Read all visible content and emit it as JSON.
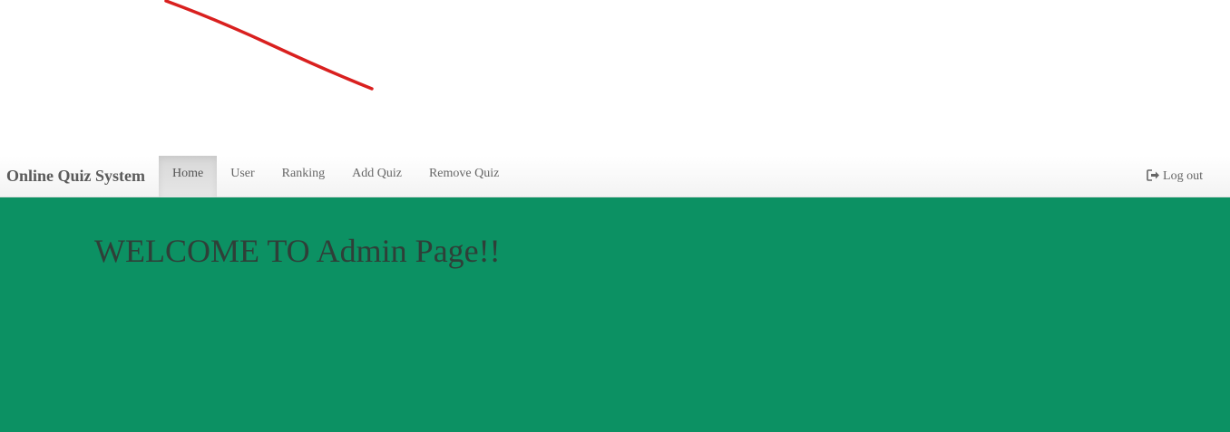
{
  "navbar": {
    "brand": "Online Quiz System",
    "items": [
      {
        "label": "Home",
        "active": true
      },
      {
        "label": "User",
        "active": false
      },
      {
        "label": "Ranking",
        "active": false
      },
      {
        "label": "Add Quiz",
        "active": false
      },
      {
        "label": "Remove Quiz",
        "active": false
      }
    ],
    "logout_label": "Log out",
    "logout_icon": "sign-out-icon"
  },
  "main": {
    "heading": "WELCOME TO Admin Page!!"
  },
  "colors": {
    "main_background": "#0c9163",
    "active_tab_background": "#dddddd",
    "annotation_stroke": "#d9201f",
    "heading_text": "#2f3f38",
    "nav_text": "#666666"
  }
}
